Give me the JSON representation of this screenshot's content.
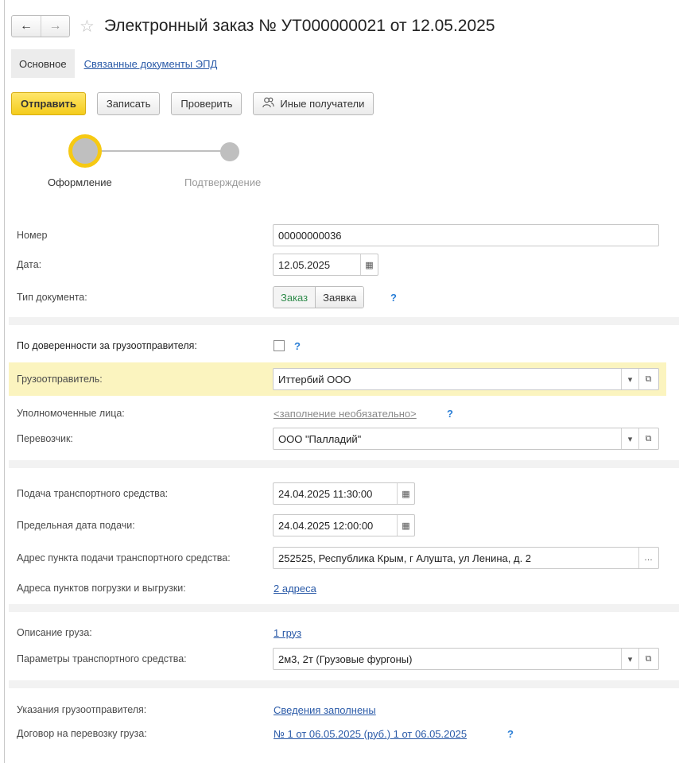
{
  "window": {
    "title": "Электронный заказ № УТ000000021 от 12.05.2025",
    "back_icon": "arrow-left-icon",
    "forward_icon": "arrow-right-icon",
    "favorite_icon": "star-icon"
  },
  "tabs": {
    "main": "Основное",
    "related": "Связанные документы ЭПД"
  },
  "toolbar": {
    "send": "Отправить",
    "save": "Записать",
    "check": "Проверить",
    "other_recipients": "Иные получатели"
  },
  "stepper": {
    "step1": "Оформление",
    "step2": "Подтверждение"
  },
  "form": {
    "number_label": "Номер",
    "number_value": "00000000036",
    "date_label": "Дата:",
    "date_value": "12.05.2025",
    "doctype_label": "Тип документа:",
    "doctype_option1": "Заказ",
    "doctype_option2": "Заявка",
    "help": "?",
    "proxy_label": "По доверенности за грузоотправителя:",
    "shipper_label": "Грузоотправитель:",
    "shipper_value": "Иттербий ООО",
    "authorized_label": "Уполномоченные лица:",
    "authorized_value": "<заполнение необязательно>",
    "carrier_label": "Перевозчик:",
    "carrier_value": "ООО \"Палладий\"",
    "vehicle_supply_label": "Подача транспортного средства:",
    "vehicle_supply_value": "24.04.2025 11:30:00",
    "deadline_label": "Предельная дата подачи:",
    "deadline_value": "24.04.2025 12:00:00",
    "supply_address_label": "Адрес пункта подачи транспортного средства:",
    "supply_address_value": "252525, Республика Крым, г Алушта, ул Ленина, д. 2",
    "load_points_label": "Адреса пунктов погрузки и выгрузки:",
    "load_points_value": "2 адреса",
    "cargo_label": "Описание груза:",
    "cargo_value": "1 груз",
    "vehicle_params_label": "Параметры транспортного средства:",
    "vehicle_params_value": "2м3, 2т (Грузовые фургоны)",
    "shipper_instructions_label": "Указания грузоотправителя:",
    "shipper_instructions_value": "Сведения заполнены",
    "contract_label": "Договор на перевозку груза:",
    "contract_value": "№ 1 от 06.05.2025 (руб.) 1 от 06.05.2025"
  },
  "colors": {
    "accent_yellow": "#f6c913",
    "link_blue": "#2a5aa8",
    "highlight": "#fbf4bf"
  }
}
